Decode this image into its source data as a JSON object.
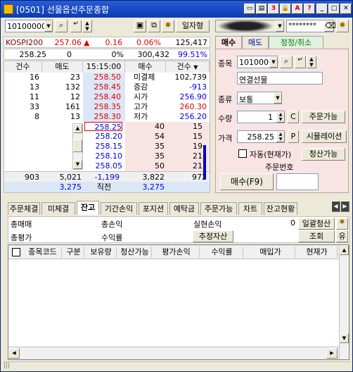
{
  "window": {
    "title": "[0501] 선물옵션주문종합",
    "daily_label": "일자형"
  },
  "code": {
    "value": "10100000"
  },
  "quote": {
    "name": "KOSPI200",
    "price": "257.06",
    "change": "0.16",
    "rate": "0.06%",
    "volume": "125,417",
    "base": "258.25",
    "v2": "0",
    "v3": "0%",
    "v4": "300,432",
    "v5": "99.51%"
  },
  "orderbook": {
    "headers": [
      "건수",
      "매도",
      "15:15:00",
      "매수",
      "건수"
    ],
    "asks": [
      {
        "cnt": "16",
        "qty": "23",
        "price": "258.50",
        "label": "미결제",
        "lv": "102,739"
      },
      {
        "cnt": "13",
        "qty": "132",
        "price": "258.45",
        "label": "증감",
        "lv": "-913"
      },
      {
        "cnt": "11",
        "qty": "12",
        "price": "258.40",
        "label": "시가",
        "lv": "256.90"
      },
      {
        "cnt": "33",
        "qty": "161",
        "price": "258.35",
        "label": "고가",
        "lv": "260.30"
      },
      {
        "cnt": "8",
        "qty": "13",
        "price": "258.30",
        "label": "저가",
        "lv": "256.20"
      }
    ],
    "bids": [
      {
        "price": "258.25",
        "qty": "40",
        "cnt": "15"
      },
      {
        "price": "258.20",
        "qty": "54",
        "cnt": "15"
      },
      {
        "price": "258.15",
        "qty": "35",
        "cnt": "19"
      },
      {
        "price": "258.10",
        "qty": "35",
        "cnt": "21"
      },
      {
        "price": "258.05",
        "qty": "50",
        "cnt": "21"
      }
    ],
    "sum": {
      "a": "903",
      "b": "5,021",
      "c": "-1,199",
      "d": "3,822",
      "e": "972"
    },
    "last": {
      "a": "3,275",
      "b": "직전",
      "c": "3,275"
    }
  },
  "order": {
    "account_mask": "********",
    "tabs": [
      "매수",
      "매도",
      "정정/취소"
    ],
    "code_label": "종목",
    "code_value": "10100000",
    "item_name": "연결선물",
    "type_label": "종류",
    "type_value": "보통",
    "qty_label": "수량",
    "qty_value": "1",
    "c_btn": "C",
    "avail_btn": "주문가능",
    "price_label": "가격",
    "price_value": "258.25",
    "p_btn": "P",
    "sim_btn": "시뮬레이션",
    "auto_label": "자동(현재가)",
    "clear_btn": "청산가능",
    "order_no_label": "주문번호",
    "buy_btn": "매수(F9)"
  },
  "bottom": {
    "tabs": [
      "주문체결",
      "미체결",
      "잔고",
      "기간손익",
      "포지션",
      "예탁금",
      "주문가능",
      "차트",
      "잔고현황"
    ],
    "r1": {
      "buy_label": "총매매",
      "pnl_label": "총손익",
      "real_label": "실현손익",
      "real_value": "0",
      "close_btn": "일괄청산"
    },
    "r2": {
      "eval_label": "총평가",
      "rate_label": "수익률",
      "est_btn": "추정자산",
      "query_btn": "조회",
      "yu": "유"
    },
    "cols": [
      "종목코드",
      "구분",
      "보유량",
      "청산가능",
      "평가손익",
      "수익률",
      "매입가",
      "현재가"
    ]
  },
  "colors": {
    "ask_bg": "#dbe7f7",
    "bid_bg": "#f9e4e4",
    "title": "#0a3cb0"
  }
}
